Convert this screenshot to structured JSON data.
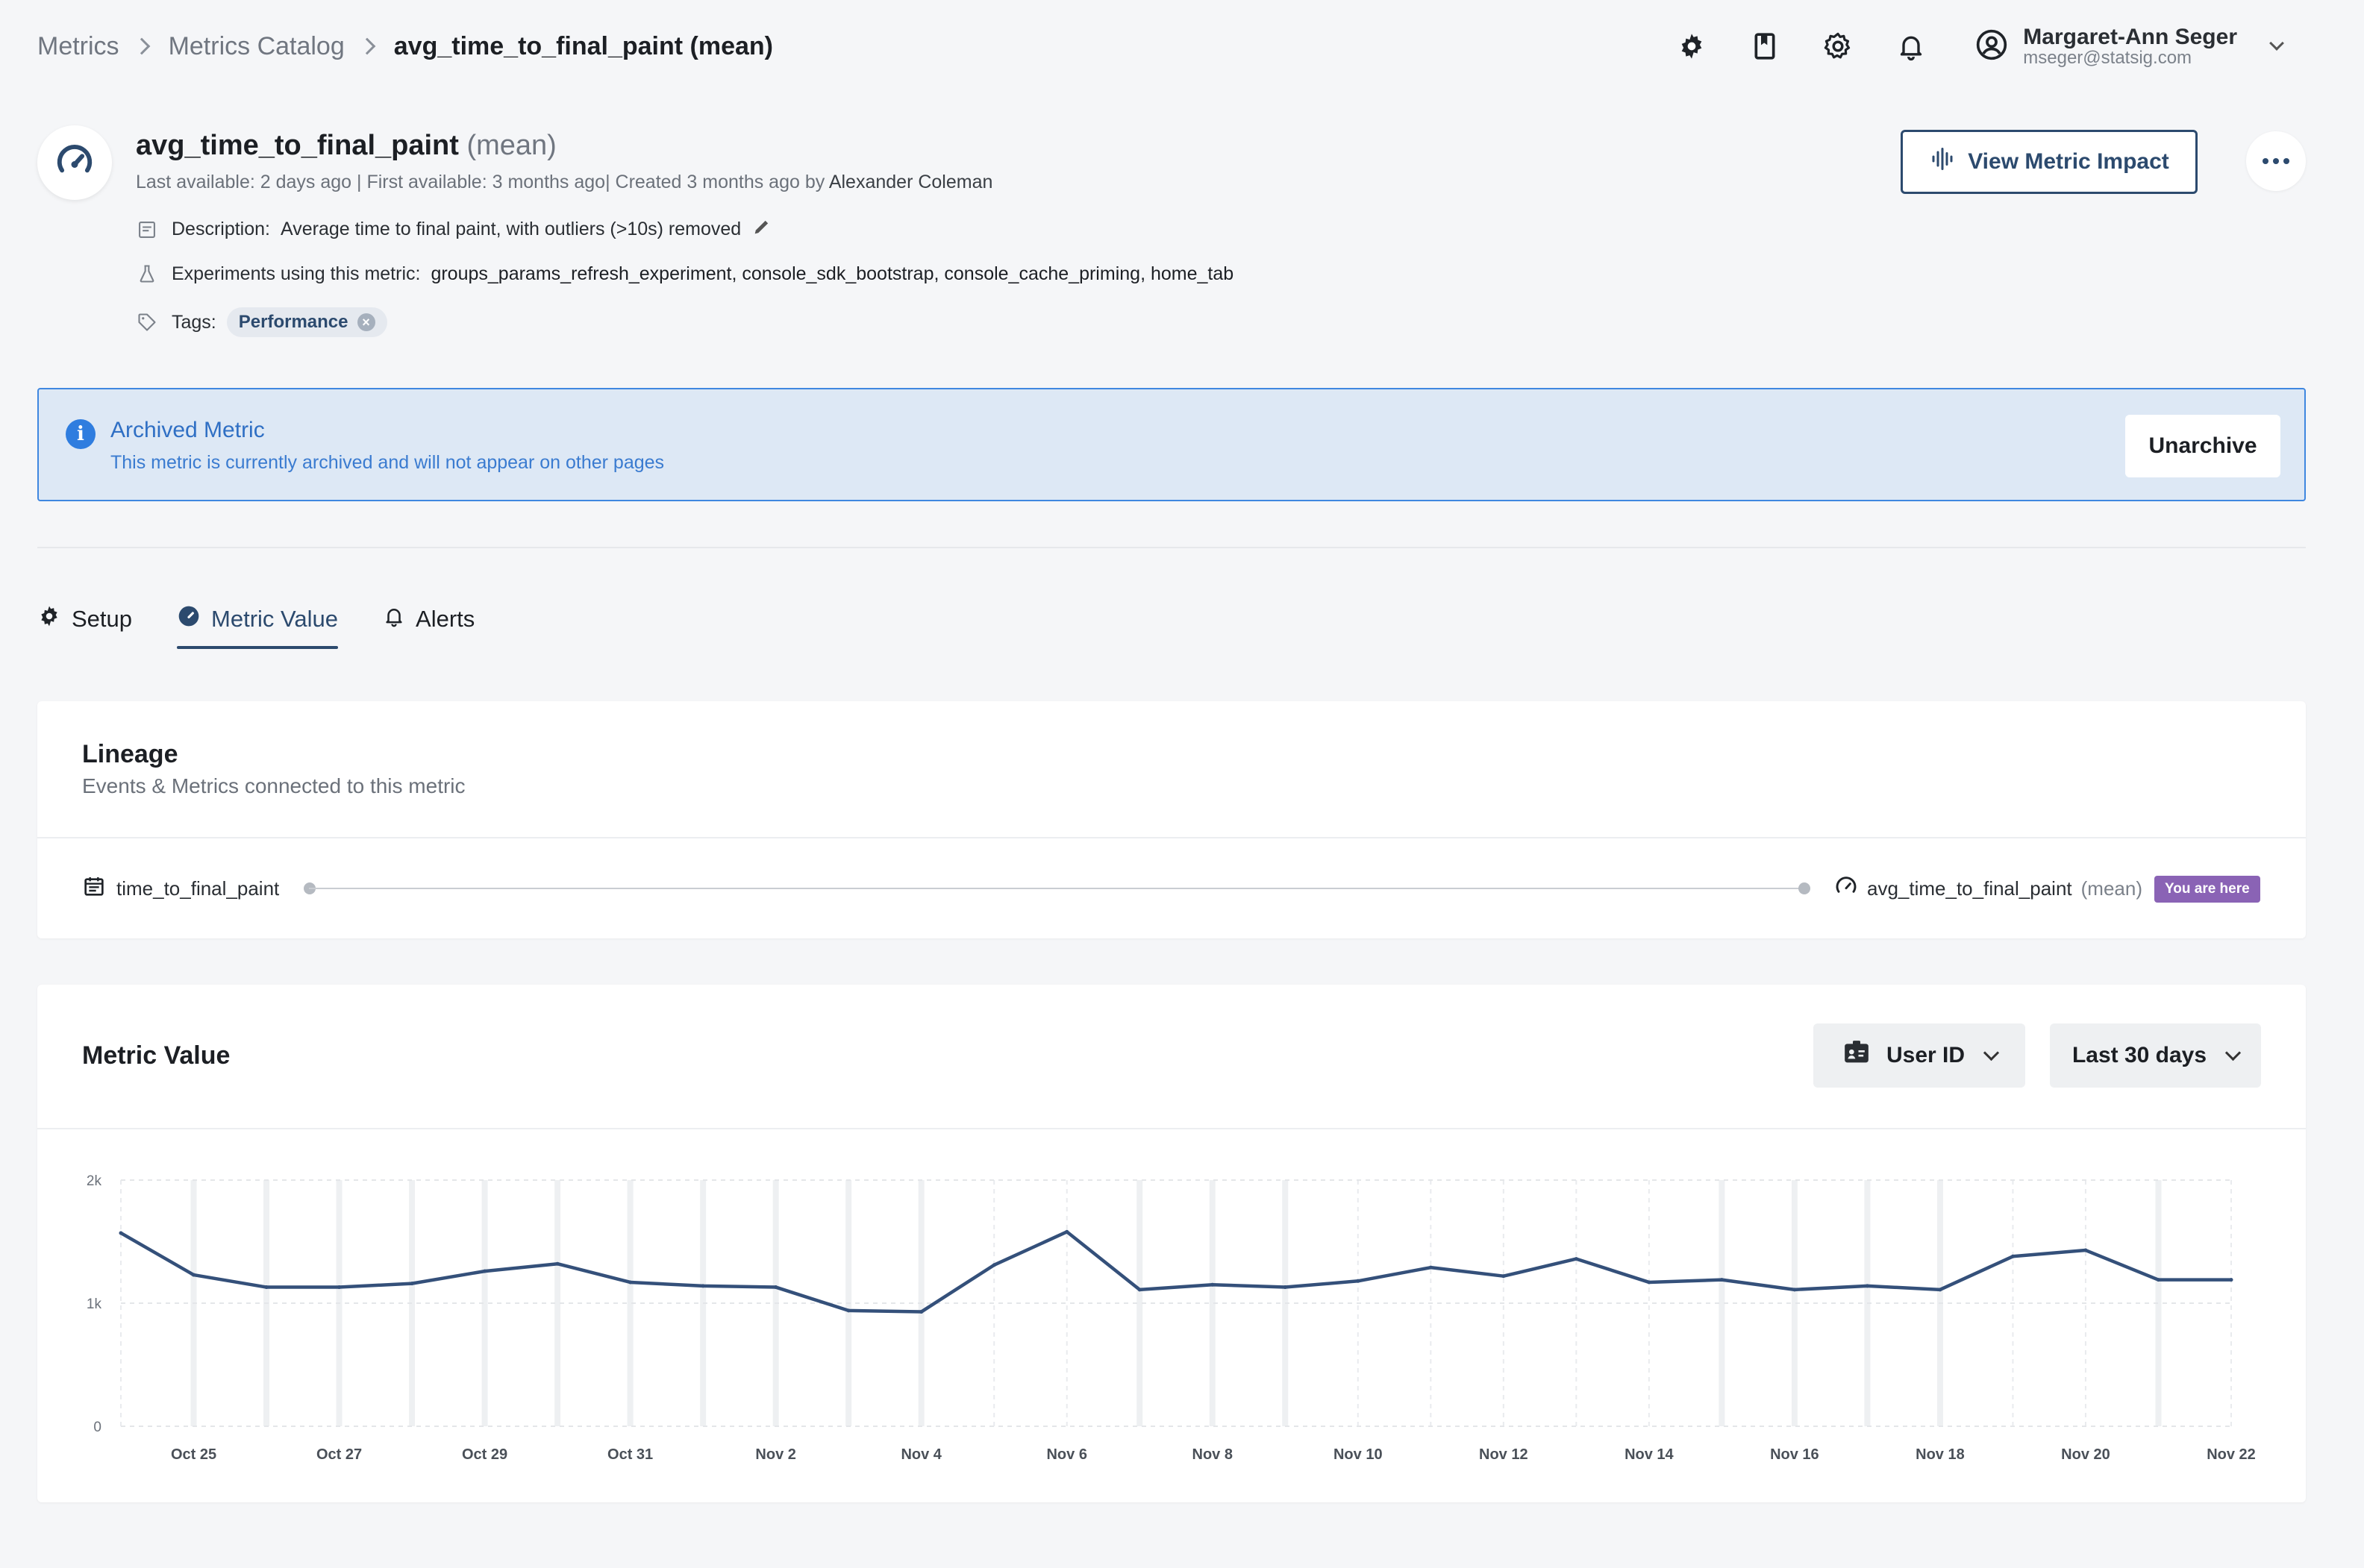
{
  "breadcrumb": {
    "items": [
      "Metrics",
      "Metrics Catalog"
    ],
    "current": "avg_time_to_final_paint (mean)"
  },
  "user": {
    "name": "Margaret-Ann Seger",
    "email": "mseger@statsig.com"
  },
  "icons": [
    "gear-cog-icon",
    "book-icon",
    "settings-icon",
    "bell-icon",
    "user-circle-icon"
  ],
  "metric": {
    "name": "avg_time_to_final_paint",
    "aggregation": "(mean)",
    "subline_prefix": "Last available: 2 days ago | First available: 3 months ago| Created 3 months ago by",
    "creator": "Alexander Coleman",
    "description_label": "Description:",
    "description": "Average time to final paint, with outliers (>10s) removed",
    "experiments_label": "Experiments using this metric:",
    "experiments": [
      "groups_params_refresh_experiment",
      "console_sdk_bootstrap",
      "console_cache_priming",
      "home_tab"
    ],
    "tags_label": "Tags:",
    "tags": [
      "Performance"
    ]
  },
  "actions": {
    "view_impact": "View Metric Impact"
  },
  "banner": {
    "title": "Archived Metric",
    "subtitle": "This metric is currently archived and will not appear on other pages",
    "button": "Unarchive"
  },
  "tabs": [
    {
      "label": "Setup",
      "active": false
    },
    {
      "label": "Metric Value",
      "active": true
    },
    {
      "label": "Alerts",
      "active": false
    }
  ],
  "lineage": {
    "title": "Lineage",
    "subtitle": "Events & Metrics connected to this metric",
    "source": "time_to_final_paint",
    "target": "avg_time_to_final_paint",
    "target_agg": "(mean)",
    "badge": "You are here"
  },
  "metric_value": {
    "title": "Metric Value",
    "unit_selector": "User ID",
    "range_selector": "Last 30 days"
  },
  "colors": {
    "line": "#34507a",
    "accent": "#2c4a6e",
    "badge": "#8a63b5",
    "banner_border": "#3f87e0"
  },
  "chart_data": {
    "type": "line",
    "title": "",
    "xlabel": "",
    "ylabel": "",
    "ylim": [
      0,
      2000
    ],
    "yticks": [
      "0",
      "1k",
      "2k"
    ],
    "grid": true,
    "x": [
      "Oct 24",
      "Oct 25",
      "Oct 26",
      "Oct 27",
      "Oct 28",
      "Oct 29",
      "Oct 30",
      "Oct 31",
      "Nov 1",
      "Nov 2",
      "Nov 3",
      "Nov 4",
      "Nov 5",
      "Nov 6",
      "Nov 7",
      "Nov 8",
      "Nov 9",
      "Nov 10",
      "Nov 11",
      "Nov 12",
      "Nov 13",
      "Nov 14",
      "Nov 15",
      "Nov 16",
      "Nov 17",
      "Nov 18",
      "Nov 19",
      "Nov 20",
      "Nov 21",
      "Nov 22"
    ],
    "xtick_labels": [
      "Oct 25",
      "Oct 27",
      "Oct 29",
      "Oct 31",
      "Nov 2",
      "Nov 4",
      "Nov 6",
      "Nov 8",
      "Nov 10",
      "Nov 12",
      "Nov 14",
      "Nov 16",
      "Nov 18",
      "Nov 20",
      "Nov 22"
    ],
    "series": [
      {
        "values": [
          1570,
          1230,
          1130,
          1130,
          1160,
          1260,
          1320,
          1170,
          1140,
          1130,
          940,
          930,
          1310,
          1580,
          1110,
          1150,
          1130,
          1180,
          1290,
          1220,
          1360,
          1170,
          1190,
          1110,
          1140,
          1110,
          1380,
          1430,
          1190,
          1190
        ]
      }
    ]
  }
}
